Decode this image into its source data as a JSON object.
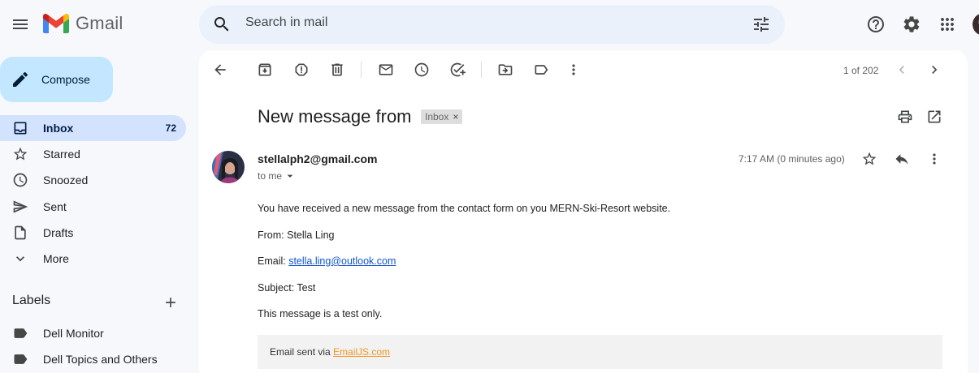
{
  "app": {
    "logo_text": "Gmail"
  },
  "search": {
    "placeholder": "Search in mail"
  },
  "sidebar": {
    "compose_label": "Compose",
    "items": [
      {
        "label": "Inbox",
        "count": "72"
      },
      {
        "label": "Starred"
      },
      {
        "label": "Snoozed"
      },
      {
        "label": "Sent"
      },
      {
        "label": "Drafts"
      },
      {
        "label": "More"
      }
    ],
    "labels_heading": "Labels",
    "labels": [
      {
        "label": "Dell Monitor"
      },
      {
        "label": "Dell Topics and Others"
      }
    ]
  },
  "toolbar": {
    "pager": "1 of 202"
  },
  "email": {
    "subject": "New message from",
    "chip": "Inbox",
    "chip_close": "×",
    "sender": "stellalph2@gmail.com",
    "to": "to me",
    "time": "7:17 AM (0 minutes ago)",
    "body": {
      "intro": "You have received a new message from the contact form on you MERN-Ski-Resort website.",
      "from": "From: Stella Ling",
      "email_label": "Email: ",
      "email_link": "stella.ling@outlook.com",
      "subject_line": "Subject: Test",
      "message": "This message is a test only."
    },
    "footer": {
      "text": "Email sent via ",
      "link": "EmailJS.com"
    }
  },
  "colors": {
    "background": "#f6f8fc",
    "compose": "#c2e7ff",
    "active_nav": "#d3e3fd",
    "search": "#eaf1fb",
    "link": "#1155cc",
    "footer_link": "#f29420"
  },
  "icons": [
    "menu-icon",
    "gmail-logo-icon",
    "search-icon",
    "tune-icon",
    "help-icon",
    "settings-icon",
    "apps-icon",
    "pencil-icon",
    "inbox-icon",
    "star-icon",
    "clock-icon",
    "send-icon",
    "draft-icon",
    "chevron-down-icon",
    "plus-icon",
    "label-icon",
    "back-arrow-icon",
    "archive-icon",
    "report-spam-icon",
    "trash-icon",
    "mark-unread-icon",
    "snooze-icon",
    "add-task-icon",
    "move-to-icon",
    "label-as-icon",
    "more-vert-icon",
    "chevron-left-icon",
    "chevron-right-icon",
    "print-icon",
    "open-new-window-icon",
    "reply-icon"
  ]
}
